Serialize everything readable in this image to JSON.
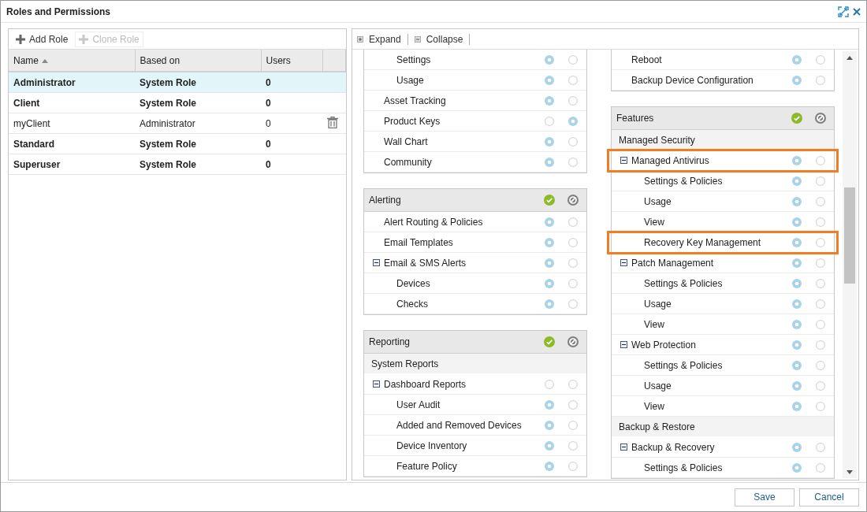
{
  "window": {
    "title": "Roles and Permissions"
  },
  "roles_toolbar": [
    {
      "label": "Add Role",
      "disabled": false
    },
    {
      "label": "Clone Role",
      "disabled": true
    }
  ],
  "roles_table": {
    "columns": [
      {
        "label": "Name",
        "sorted": true
      },
      {
        "label": "Based on",
        "sorted": false
      },
      {
        "label": "Users",
        "sorted": false
      }
    ],
    "rows": [
      {
        "name": "Administrator",
        "based_on": "System Role",
        "users": "0",
        "system": true,
        "selected": true,
        "deletable": false
      },
      {
        "name": "Client",
        "based_on": "System Role",
        "users": "0",
        "system": true,
        "selected": false,
        "deletable": false
      },
      {
        "name": "myClient",
        "based_on": "Administrator",
        "users": "0",
        "system": false,
        "selected": false,
        "deletable": true
      },
      {
        "name": "Standard",
        "based_on": "System Role",
        "users": "0",
        "system": true,
        "selected": false,
        "deletable": false
      },
      {
        "name": "Superuser",
        "based_on": "System Role",
        "users": "0",
        "system": true,
        "selected": false,
        "deletable": false
      }
    ]
  },
  "permissions_toolbar": [
    {
      "label": "Expand",
      "kind": "expand"
    },
    {
      "label": "Collapse",
      "kind": "collapse"
    }
  ],
  "columns": [
    {
      "sections": [
        {
          "rows": [
            {
              "kind": "continued",
              "children": [
                {
                  "kind": "item",
                  "label": "Settings",
                  "allowed": true,
                  "denied": false
                },
                {
                  "kind": "item",
                  "label": "Usage",
                  "allowed": true,
                  "denied": false
                }
              ]
            },
            {
              "kind": "item",
              "label": "Asset Tracking",
              "allowed": true,
              "denied": false
            },
            {
              "kind": "item",
              "label": "Product Keys",
              "allowed": false,
              "denied": true
            },
            {
              "kind": "item",
              "label": "Wall Chart",
              "allowed": true,
              "denied": false
            },
            {
              "kind": "item",
              "label": "Community",
              "allowed": true,
              "denied": false
            }
          ]
        },
        {
          "title": "Alerting",
          "rows": [
            {
              "kind": "item",
              "label": "Alert Routing & Policies",
              "allowed": true,
              "denied": false
            },
            {
              "kind": "item",
              "label": "Email Templates",
              "allowed": true,
              "denied": false
            },
            {
              "kind": "item",
              "label": "Email & SMS Alerts",
              "allowed": true,
              "denied": false,
              "expanded": true,
              "children": [
                {
                  "kind": "item",
                  "label": "Devices",
                  "allowed": true,
                  "denied": false
                },
                {
                  "kind": "item",
                  "label": "Checks",
                  "allowed": true,
                  "denied": false
                }
              ]
            }
          ]
        },
        {
          "title": "Reporting",
          "rows": [
            {
              "kind": "group",
              "label": "System Reports",
              "children": [
                {
                  "kind": "item",
                  "label": "Dashboard Reports",
                  "allowed": false,
                  "denied": false,
                  "expanded": true,
                  "children": [
                    {
                      "kind": "item",
                      "label": "User Audit",
                      "allowed": true,
                      "denied": false
                    },
                    {
                      "kind": "item",
                      "label": "Added and Removed Devices",
                      "allowed": true,
                      "denied": false
                    },
                    {
                      "kind": "item",
                      "label": "Device Inventory",
                      "allowed": true,
                      "denied": false
                    },
                    {
                      "kind": "item",
                      "label": "Feature Policy",
                      "allowed": true,
                      "denied": false
                    }
                  ]
                }
              ]
            }
          ]
        }
      ]
    },
    {
      "sections": [
        {
          "rows": [
            {
              "kind": "item",
              "label": "Reboot",
              "allowed": true,
              "denied": false
            },
            {
              "kind": "item",
              "label": "Backup Device Configuration",
              "allowed": true,
              "denied": false
            }
          ]
        },
        {
          "title": "Features",
          "rows": [
            {
              "kind": "group",
              "label": "Managed Security",
              "children": [
                {
                  "kind": "item",
                  "label": "Managed Antivirus",
                  "allowed": true,
                  "denied": false,
                  "expanded": true,
                  "highlighted": true,
                  "children": [
                    {
                      "kind": "item",
                      "label": "Settings & Policies",
                      "allowed": true,
                      "denied": false
                    },
                    {
                      "kind": "item",
                      "label": "Usage",
                      "allowed": true,
                      "denied": false
                    },
                    {
                      "kind": "item",
                      "label": "View",
                      "allowed": true,
                      "denied": false
                    },
                    {
                      "kind": "item",
                      "label": "Recovery Key Management",
                      "allowed": true,
                      "denied": false,
                      "highlighted": true
                    }
                  ]
                },
                {
                  "kind": "item",
                  "label": "Patch Management",
                  "allowed": true,
                  "denied": false,
                  "expanded": true,
                  "children": [
                    {
                      "kind": "item",
                      "label": "Settings & Policies",
                      "allowed": true,
                      "denied": false
                    },
                    {
                      "kind": "item",
                      "label": "Usage",
                      "allowed": true,
                      "denied": false
                    },
                    {
                      "kind": "item",
                      "label": "View",
                      "allowed": true,
                      "denied": false
                    }
                  ]
                },
                {
                  "kind": "item",
                  "label": "Web Protection",
                  "allowed": true,
                  "denied": false,
                  "expanded": true,
                  "children": [
                    {
                      "kind": "item",
                      "label": "Settings & Policies",
                      "allowed": true,
                      "denied": false
                    },
                    {
                      "kind": "item",
                      "label": "Usage",
                      "allowed": true,
                      "denied": false
                    },
                    {
                      "kind": "item",
                      "label": "View",
                      "allowed": true,
                      "denied": false
                    }
                  ]
                }
              ]
            },
            {
              "kind": "group",
              "label": "Backup & Restore",
              "children": [
                {
                  "kind": "item",
                  "label": "Backup & Recovery",
                  "allowed": true,
                  "denied": false,
                  "expanded": true,
                  "children": [
                    {
                      "kind": "item",
                      "label": "Settings & Policies",
                      "allowed": true,
                      "denied": false
                    }
                  ]
                }
              ]
            }
          ]
        }
      ]
    }
  ],
  "footer_buttons": [
    "Save",
    "Cancel"
  ]
}
